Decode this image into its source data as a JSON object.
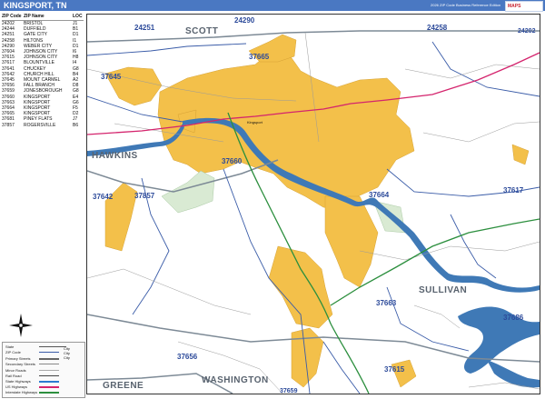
{
  "header": {
    "title": "KINGSPORT, TN",
    "edition": "2026 ZIP Code Business Reference Edition",
    "logo_text": "MAPS",
    "color": "#4a78c2"
  },
  "index": {
    "headers": [
      "ZIP Code",
      "ZIP Name",
      "LOC"
    ],
    "rows": [
      [
        "24202",
        "BRISTOL",
        "J1"
      ],
      [
        "24244",
        "DUFFIELD",
        "B1"
      ],
      [
        "24251",
        "GATE CITY",
        "D1"
      ],
      [
        "24258",
        "HILTONS",
        "I1"
      ],
      [
        "24290",
        "WEBER CITY",
        "D1"
      ],
      [
        "37604",
        "JOHNSON CITY",
        "I6"
      ],
      [
        "37615",
        "JOHNSON CITY",
        "H8"
      ],
      [
        "37617",
        "BLOUNTVILLE",
        "I4"
      ],
      [
        "37641",
        "CHUCKEY",
        "G8"
      ],
      [
        "37642",
        "CHURCH HILL",
        "B4"
      ],
      [
        "37645",
        "MOUNT CARMEL",
        "A2"
      ],
      [
        "37656",
        "FALL BRANCH",
        "D8"
      ],
      [
        "37659",
        "JONESBOROUGH",
        "G8"
      ],
      [
        "37660",
        "KINGSPORT",
        "E4"
      ],
      [
        "37663",
        "KINGSPORT",
        "G6"
      ],
      [
        "37664",
        "KINGSPORT",
        "F5"
      ],
      [
        "37665",
        "KINGSPORT",
        "D2"
      ],
      [
        "37681",
        "PINEY FLATS",
        "J7"
      ],
      [
        "37857",
        "ROGERSVILLE",
        "B6"
      ]
    ]
  },
  "map": {
    "colors": {
      "urban": "#f3c04a",
      "water": "#3f79b6",
      "park": "#d9ead3",
      "zip_boundary": "#3a5ca8",
      "county_boundary": "#7d8a96",
      "highway": "#d4246d",
      "interstate": "#2c8f3e",
      "road": "#8a8a8a"
    },
    "zips": [
      {
        "code": "24251",
        "side": "top"
      },
      {
        "code": "24290",
        "side": "top"
      },
      {
        "code": "24258",
        "side": "top"
      },
      {
        "code": "24202",
        "side": "top"
      },
      {
        "code": "37645",
        "side": "left"
      },
      {
        "code": "37665",
        "side": "center"
      },
      {
        "code": "37660",
        "side": "center"
      },
      {
        "code": "37642",
        "side": "left"
      },
      {
        "code": "37857",
        "side": "left"
      },
      {
        "code": "37664",
        "side": "center"
      },
      {
        "code": "37617",
        "side": "right"
      },
      {
        "code": "37663",
        "side": "center"
      },
      {
        "code": "37686",
        "side": "right"
      },
      {
        "code": "37656",
        "side": "bottom"
      },
      {
        "code": "37615",
        "side": "bottom"
      },
      {
        "code": "37659",
        "side": "bottom"
      }
    ],
    "counties": [
      "SCOTT",
      "HAWKINS",
      "SULLIVAN",
      "WASHINGTON",
      "GREENE"
    ],
    "city_label": "Kingsport"
  },
  "compass": {
    "icon": "compass-rose-icon"
  },
  "legend": {
    "items": [
      "State",
      "ZIP Code",
      "Primary Streets",
      "Secondary Streets",
      "Minor Roads",
      "Rail Road",
      "State Highways",
      "US Highways",
      "Interstate Highways"
    ],
    "city_sample": "City\nCity\nCity"
  }
}
